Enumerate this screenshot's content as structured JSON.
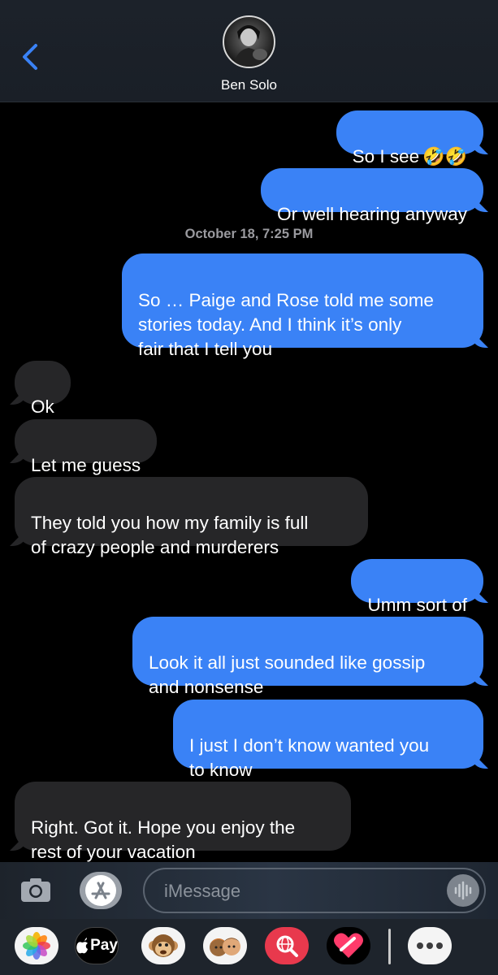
{
  "header": {
    "contact_name": "Ben Solo"
  },
  "messages": [
    {
      "side": "sent",
      "text": "So I see",
      "emoji": "🤣🤣"
    },
    {
      "side": "sent",
      "text": "Or well hearing anyway"
    },
    {
      "side": "timestamp",
      "text": "October 18, 7:25 PM"
    },
    {
      "side": "sent",
      "text": "So … Paige and Rose told me some\nstories today. And I think it’s only\nfair that I tell you"
    },
    {
      "side": "received",
      "text": "Ok"
    },
    {
      "side": "received",
      "text": "Let me guess"
    },
    {
      "side": "received",
      "text": "They told you how my family is full\nof crazy people and murderers"
    },
    {
      "side": "sent",
      "text": "Umm sort of"
    },
    {
      "side": "sent",
      "text": "Look it all just sounded like gossip\nand nonsense"
    },
    {
      "side": "sent",
      "text": "I just I don’t know wanted you\nto know"
    },
    {
      "side": "received",
      "text": "Right. Got it. Hope you enjoy the\nrest of your vacation"
    }
  ],
  "composer": {
    "placeholder": "iMessage"
  },
  "app_drawer": {
    "apple_pay_label": "Pay"
  },
  "colors": {
    "sent_bubble": "#3a82f6",
    "received_bubble": "#262628",
    "accent_blue": "#3a82f6"
  },
  "icons": [
    "chevron-left-icon",
    "camera-icon",
    "app-store-icon",
    "audio-waveform-icon",
    "photos-icon",
    "apple-pay-icon",
    "monkey-emoji-icon",
    "memoji-icon",
    "web-search-icon",
    "heart-sticker-icon",
    "more-icon"
  ]
}
